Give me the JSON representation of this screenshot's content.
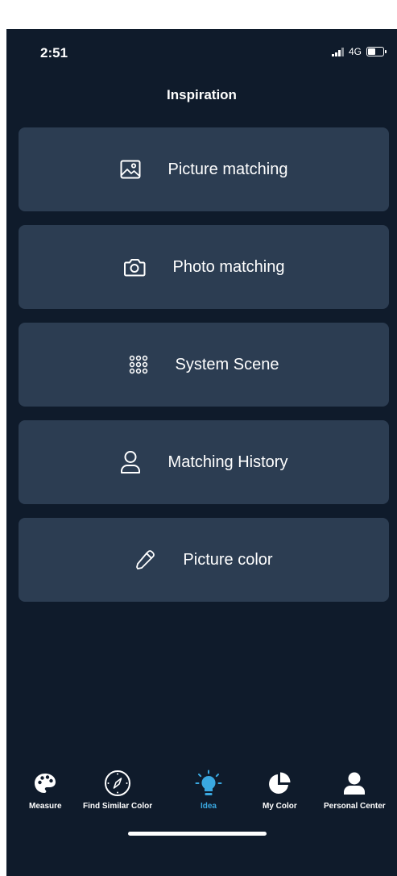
{
  "status_bar": {
    "time": "2:51",
    "network": "4G"
  },
  "header": {
    "title": "Inspiration"
  },
  "menu": [
    {
      "label": "Picture matching",
      "icon": "image-icon"
    },
    {
      "label": "Photo matching",
      "icon": "camera-icon"
    },
    {
      "label": "System Scene",
      "icon": "grid-dots-icon"
    },
    {
      "label": "Matching History",
      "icon": "person-icon"
    },
    {
      "label": "Picture color",
      "icon": "eyedropper-icon"
    }
  ],
  "bottom_nav": [
    {
      "label": "Measure",
      "icon": "palette-icon",
      "active": false
    },
    {
      "label": "Find Similar Color",
      "icon": "compass-icon",
      "active": false
    },
    {
      "label": "Idea",
      "icon": "lightbulb-icon",
      "active": true
    },
    {
      "label": "My Color",
      "icon": "pie-chart-icon",
      "active": false
    },
    {
      "label": "Personal Center",
      "icon": "user-icon",
      "active": false
    }
  ],
  "colors": {
    "background": "#0f1b2b",
    "card": "#2c3d52",
    "text": "#ffffff",
    "accent": "#3aa8e0"
  }
}
